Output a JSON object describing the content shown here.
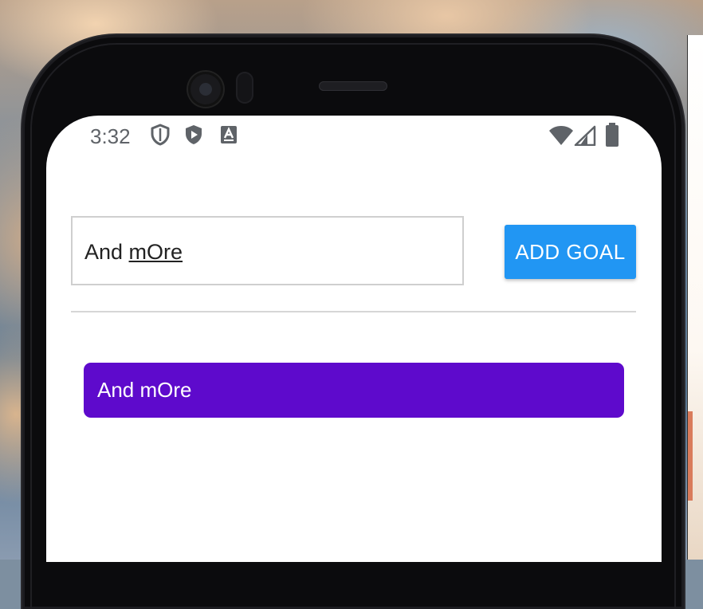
{
  "status_bar": {
    "time": "3:32",
    "icons": [
      "shield-outline-icon",
      "shield-play-icon",
      "keyboard-a-icon",
      "wifi-icon",
      "cellular-signal-icon",
      "battery-icon"
    ]
  },
  "goal_input": {
    "value_plain": "And ",
    "value_underlined": "mOre"
  },
  "add_goal_button": {
    "label": "ADD GOAL"
  },
  "goals": [
    {
      "text": "And mOre"
    }
  ],
  "colors": {
    "button": "#2196f3",
    "goal_item": "#5e0acc",
    "status_icons": "#5f6368"
  }
}
